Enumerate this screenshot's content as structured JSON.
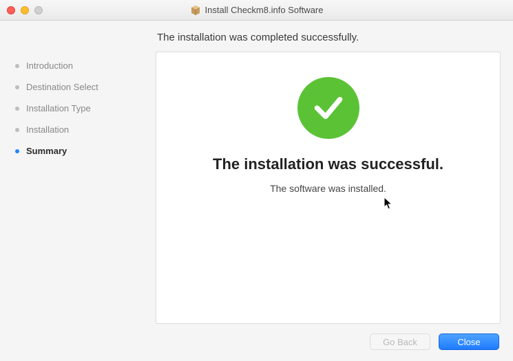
{
  "window": {
    "title": "Install Checkm8.info Software"
  },
  "header": {
    "status": "The installation was completed successfully."
  },
  "sidebar": {
    "steps": [
      {
        "label": "Introduction",
        "active": false
      },
      {
        "label": "Destination Select",
        "active": false
      },
      {
        "label": "Installation Type",
        "active": false
      },
      {
        "label": "Installation",
        "active": false
      },
      {
        "label": "Summary",
        "active": true
      }
    ]
  },
  "main": {
    "heading": "The installation was successful.",
    "subtext": "The software was installed."
  },
  "footer": {
    "go_back_label": "Go Back",
    "close_label": "Close"
  },
  "colors": {
    "success_green": "#5bc236",
    "primary_blue": "#1e7cff"
  }
}
